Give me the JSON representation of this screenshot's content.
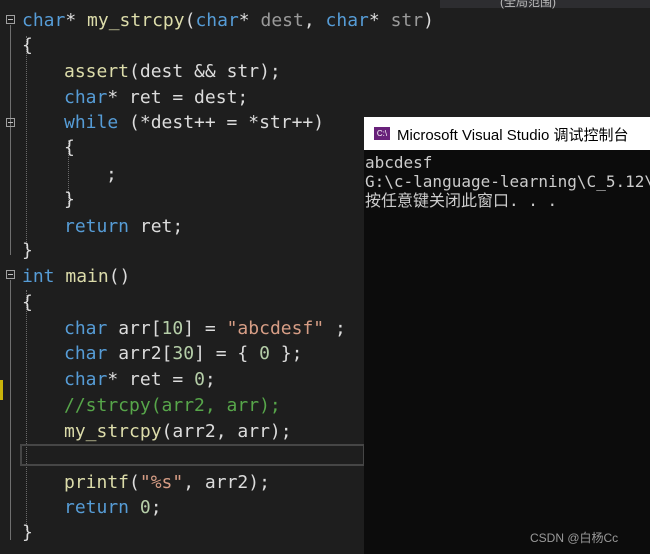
{
  "top_strip": {
    "label": "(全局范围)"
  },
  "code": {
    "l1": {
      "kw1": "char",
      "t1": "* ",
      "fn": "my_strcpy",
      "t2": "(",
      "kw2": "char",
      "t3": "* ",
      "p1": "dest",
      "t4": ", ",
      "kw3": "char",
      "t5": "* ",
      "p2": "str",
      "t6": ")"
    },
    "l2": {
      "t": "{"
    },
    "l3": {
      "fn": "assert",
      "t": "(dest && str);"
    },
    "l4": {
      "kw": "char",
      "t": "* ret = dest;"
    },
    "l5": {
      "kw": "while",
      "t": " (*dest++ = *str++)"
    },
    "l6": {
      "t": "{"
    },
    "l7": {
      "t": ";"
    },
    "l8": {
      "t": "}"
    },
    "l9": {
      "kw": "return",
      "t": " ret;"
    },
    "l10": {
      "t": "}"
    },
    "l11": {
      "kw": "int",
      "fn": "main",
      "t": "()"
    },
    "l12": {
      "t": "{"
    },
    "l13": {
      "kw": "char",
      "t1": " arr[",
      "num": "10",
      "t2": "] = ",
      "str": "\"abcdesf\"",
      "t3": " ;"
    },
    "l14": {
      "kw": "char",
      "t1": " arr2[",
      "num1": "30",
      "t2": "] = { ",
      "num2": "0",
      "t3": " };"
    },
    "l15": {
      "kw": "char",
      "t1": "* ret = ",
      "num": "0",
      "t2": ";"
    },
    "l16": {
      "cm": "//strcpy(arr2, arr);"
    },
    "l17": {
      "fn": "my_strcpy",
      "t": "(arr2, arr);"
    },
    "l18": {
      "fn": "printf",
      "t1": "(",
      "str": "\"%s\"",
      "t2": ", arr2);"
    },
    "l19": {
      "kw": "return",
      "num": "0",
      "t": ";"
    },
    "l20": {
      "t": "}"
    }
  },
  "console": {
    "icon": "C:\\",
    "title": "Microsoft Visual Studio 调试控制台",
    "lines": [
      "abcdesf",
      "G:\\c-language-learning\\C_5.12\\",
      "按任意键关闭此窗口. . ."
    ]
  },
  "watermark": "CSDN @白杨Cc"
}
